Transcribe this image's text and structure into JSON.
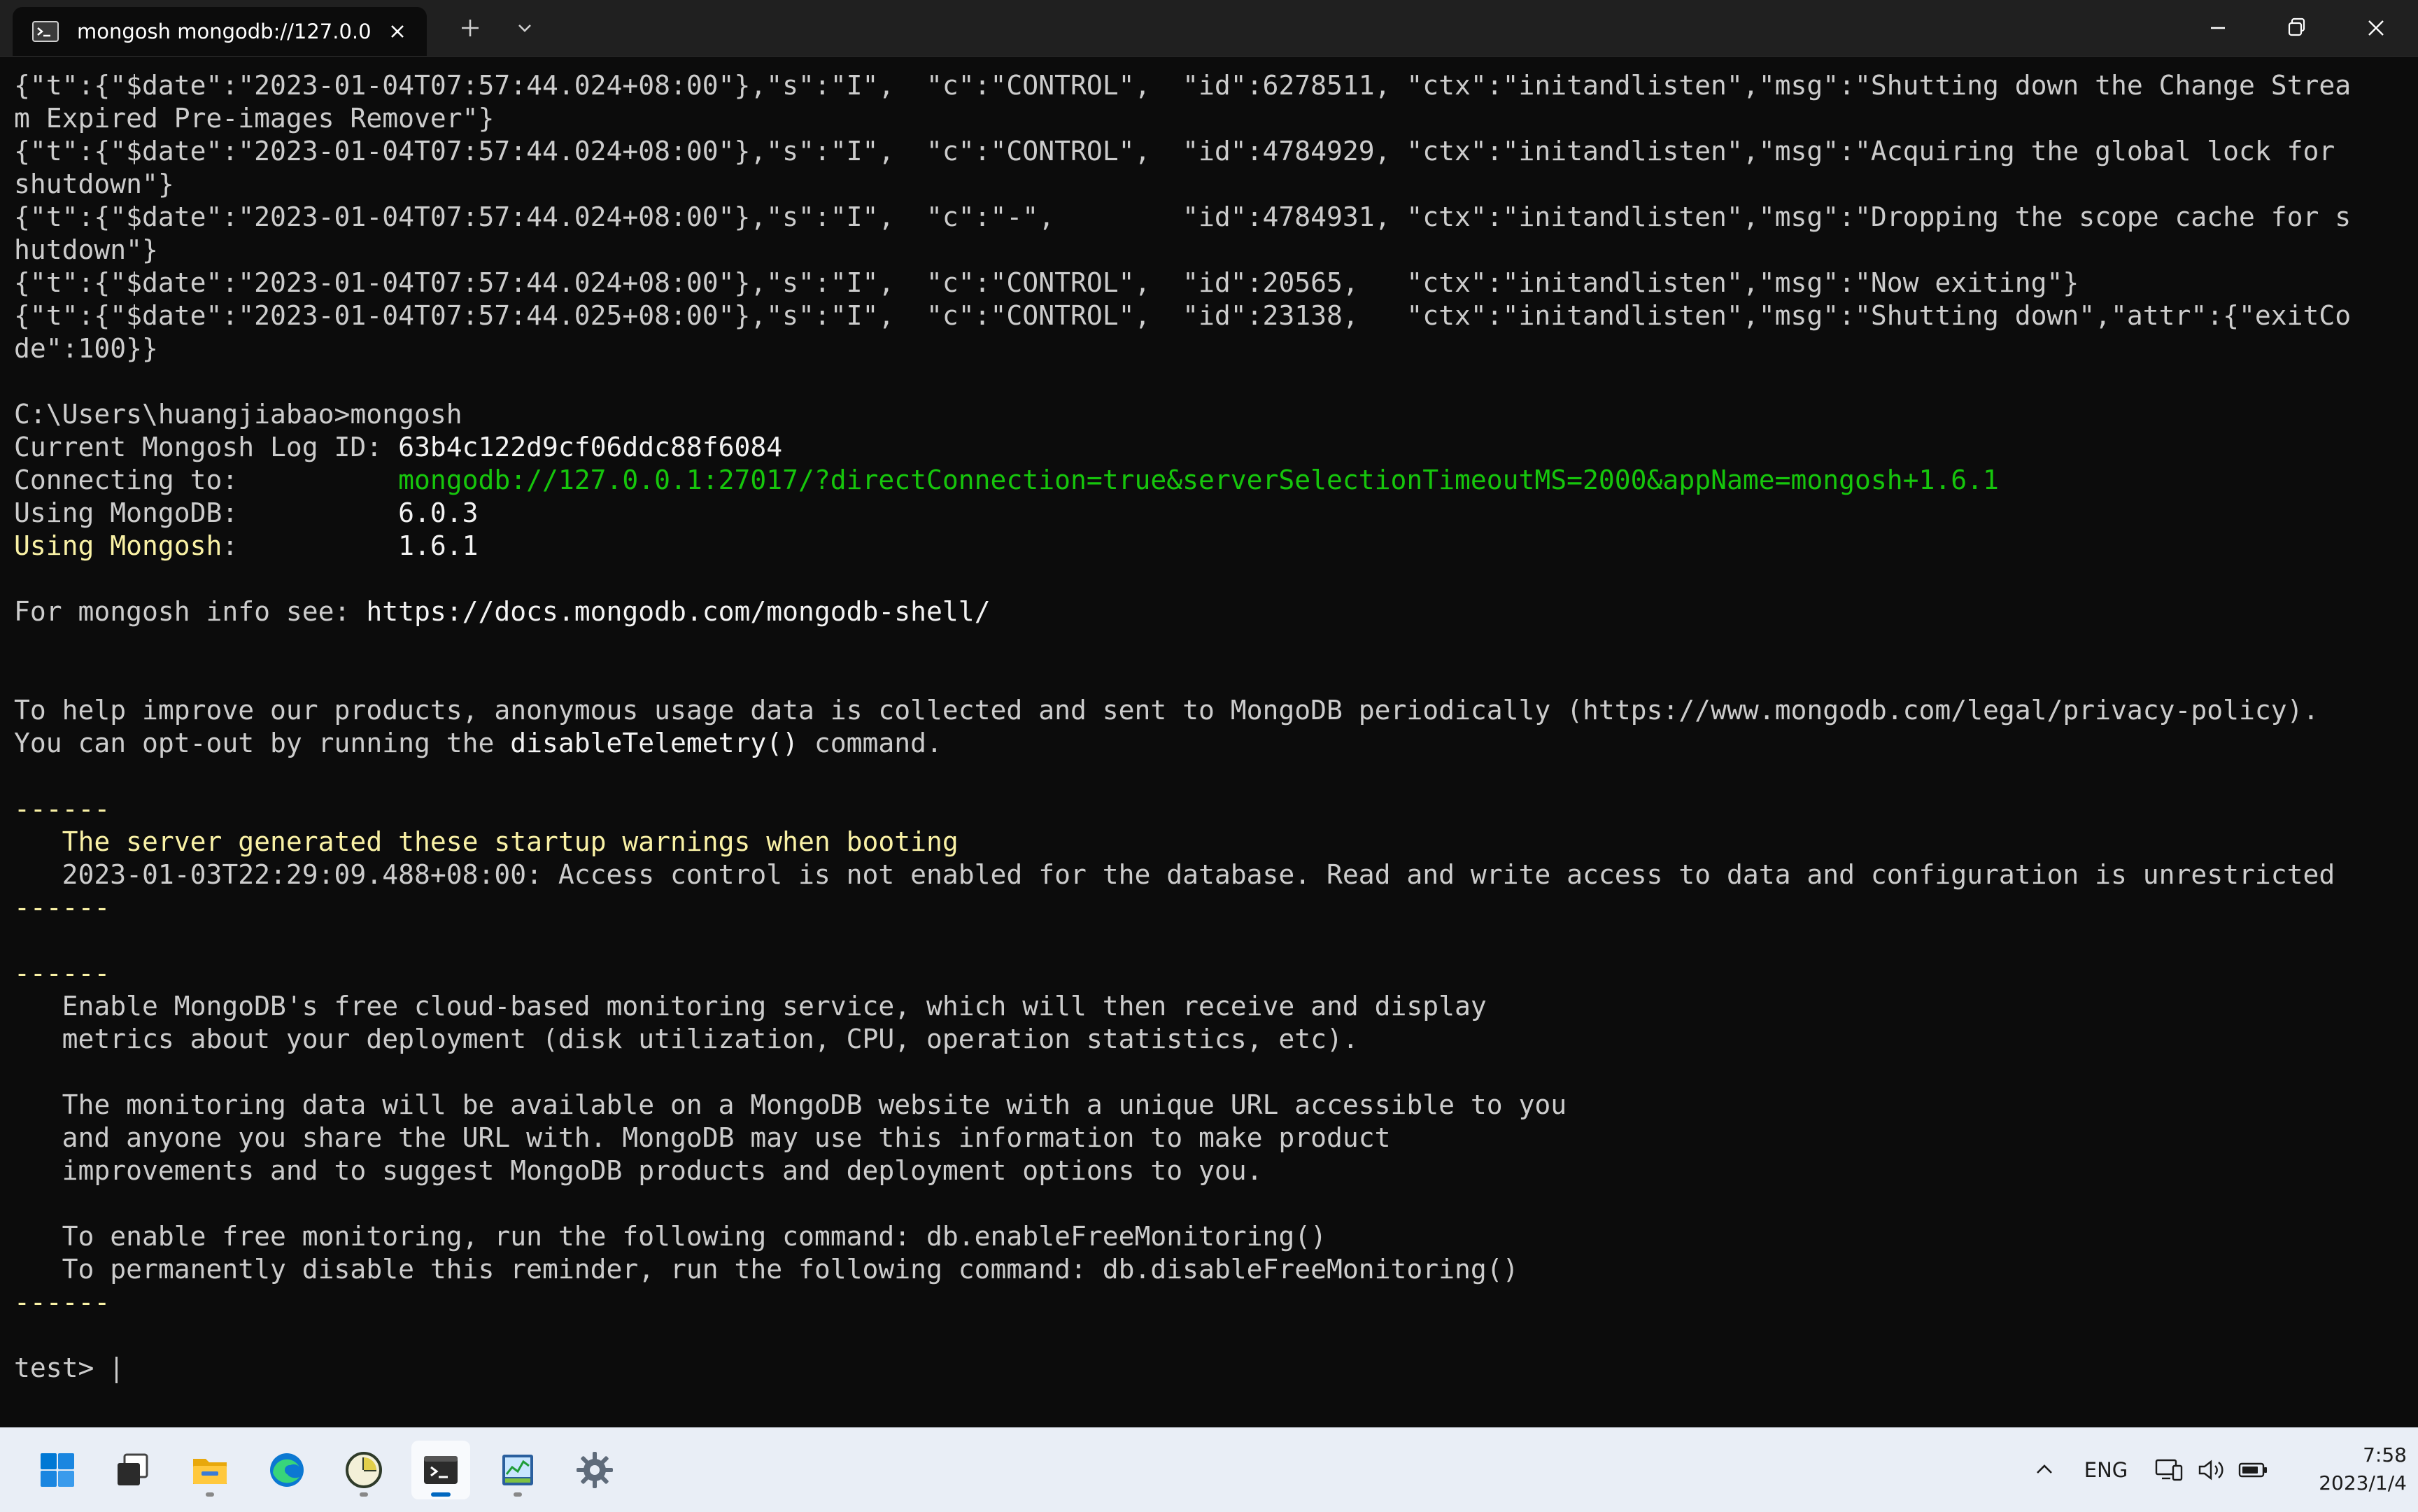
{
  "window": {
    "tab_title": "mongosh mongodb://127.0.0.",
    "colors": {
      "titlebar": "#202020",
      "terminal_bg": "#0c0c0c",
      "text": "#cccccc",
      "green": "#16c60c",
      "yellow": "#f9f1a5"
    }
  },
  "terminal": {
    "log": [
      "{\"t\":{\"$date\":\"2023-01-04T07:57:44.024+08:00\"},\"s\":\"I\",  \"c\":\"CONTROL\",  \"id\":6278511, \"ctx\":\"initandlisten\",\"msg\":\"Shutting down the Change Strea",
      "m Expired Pre-images Remover\"}",
      "{\"t\":{\"$date\":\"2023-01-04T07:57:44.024+08:00\"},\"s\":\"I\",  \"c\":\"CONTROL\",  \"id\":4784929, \"ctx\":\"initandlisten\",\"msg\":\"Acquiring the global lock for",
      "shutdown\"}",
      "{\"t\":{\"$date\":\"2023-01-04T07:57:44.024+08:00\"},\"s\":\"I\",  \"c\":\"-\",        \"id\":4784931, \"ctx\":\"initandlisten\",\"msg\":\"Dropping the scope cache for s",
      "hutdown\"}",
      "{\"t\":{\"$date\":\"2023-01-04T07:57:44.024+08:00\"},\"s\":\"I\",  \"c\":\"CONTROL\",  \"id\":20565,   \"ctx\":\"initandlisten\",\"msg\":\"Now exiting\"}",
      "{\"t\":{\"$date\":\"2023-01-04T07:57:44.025+08:00\"},\"s\":\"I\",  \"c\":\"CONTROL\",  \"id\":23138,   \"ctx\":\"initandlisten\",\"msg\":\"Shutting down\",\"attr\":{\"exitCo",
      "de\":100}}"
    ],
    "prompt_cmd": "C:\\Users\\huangjiabao>mongosh",
    "log_id_label": "Current Mongosh Log ID: ",
    "log_id": "63b4c122d9cf06ddc88f6084",
    "connecting_label": "Connecting to:          ",
    "connecting_url": "mongodb://127.0.0.1:27017/?directConnection=true&serverSelectionTimeoutMS=2000&appName=mongosh+1.6.1",
    "mongodb_label": "Using MongoDB:          ",
    "mongodb_version": "6.0.3",
    "mongosh_label": "Using Mongosh",
    "mongosh_colon": ":          ",
    "mongosh_version": "1.6.1",
    "info_label": "For mongosh info see: ",
    "info_url": "https://docs.mongodb.com/mongodb-shell/",
    "telemetry_1": "To help improve our products, anonymous usage data is collected and sent to MongoDB periodically (https://www.mongodb.com/legal/privacy-policy).",
    "telemetry_2a": "You can opt-out by running the ",
    "telemetry_2b": "disableTelemetry()",
    "telemetry_2c": " command.",
    "separator": "------",
    "warn_heading": "   The server generated these startup warnings when booting",
    "warn_line": "   2023-01-03T22:29:09.488+08:00: Access control is not enabled for the database. Read and write access to data and configuration is unrestricted",
    "monitor": [
      "   Enable MongoDB's free cloud-based monitoring service, which will then receive and display",
      "   metrics about your deployment (disk utilization, CPU, operation statistics, etc).",
      "",
      "   The monitoring data will be available on a MongoDB website with a unique URL accessible to you",
      "   and anyone you share the URL with. MongoDB may use this information to make product",
      "   improvements and to suggest MongoDB products and deployment options to you.",
      "",
      "   To enable free monitoring, run the following command: db.enableFreeMonitoring()",
      "   To permanently disable this reminder, run the following command: db.disableFreeMonitoring()"
    ],
    "prompt": "test> "
  },
  "taskbar": {
    "lang": "ENG",
    "time": "7:58",
    "date": "2023/1/4",
    "icons": [
      "windows-start-icon",
      "task-view-icon",
      "file-explorer-icon",
      "edge-browser-icon",
      "clock-app-icon",
      "terminal-icon",
      "chart-app-icon",
      "settings-gear-icon"
    ]
  }
}
